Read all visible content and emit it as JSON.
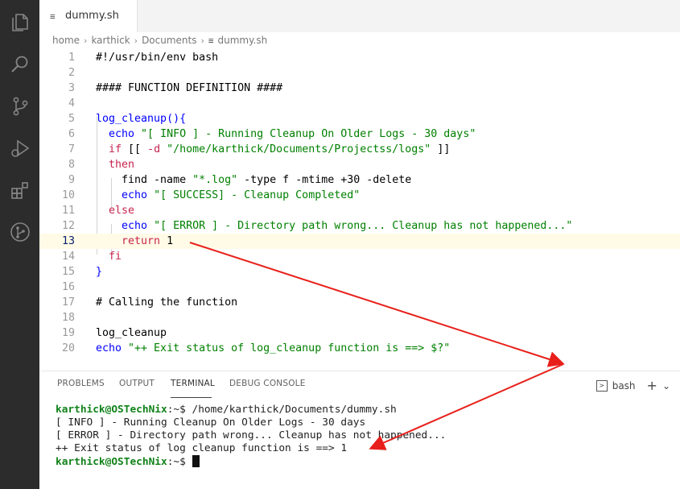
{
  "tab": {
    "label": "dummy.sh",
    "icon": "≡"
  },
  "breadcrumb": [
    "home",
    "karthick",
    "Documents",
    "dummy.sh"
  ],
  "editor": {
    "current_line": 13,
    "lines": [
      {
        "n": "1",
        "segs": [
          {
            "t": "#!/usr/bin/env bash",
            "c": "t-plain"
          }
        ]
      },
      {
        "n": "2",
        "segs": []
      },
      {
        "n": "3",
        "segs": [
          {
            "t": "#### FUNCTION DEFINITION ####",
            "c": "t-plain"
          }
        ]
      },
      {
        "n": "4",
        "segs": []
      },
      {
        "n": "5",
        "segs": [
          {
            "t": "log_cleanup",
            "c": "t-blue"
          },
          {
            "t": "(){",
            "c": "t-blue"
          }
        ]
      },
      {
        "n": "6",
        "segs": [
          {
            "t": "  echo ",
            "c": "t-blue"
          },
          {
            "t": "\"[ INFO ] - Running Cleanup On Older Logs - 30 days\"",
            "c": "cmt"
          }
        ]
      },
      {
        "n": "7",
        "segs": [
          {
            "t": "  if ",
            "c": "t-red"
          },
          {
            "t": "[[ ",
            "c": "t-plain"
          },
          {
            "t": "-d ",
            "c": "t-red"
          },
          {
            "t": "\"/home/karthick/Documents/Projectss/logs\"",
            "c": "cmt"
          },
          {
            "t": " ]]",
            "c": "t-plain"
          }
        ]
      },
      {
        "n": "8",
        "segs": [
          {
            "t": "  then",
            "c": "t-red"
          }
        ]
      },
      {
        "n": "9",
        "segs": [
          {
            "t": "    find -name ",
            "c": "t-plain"
          },
          {
            "t": "\"*.log\"",
            "c": "cmt"
          },
          {
            "t": " -type f -mtime +30 -delete",
            "c": "t-plain"
          }
        ]
      },
      {
        "n": "10",
        "segs": [
          {
            "t": "    echo ",
            "c": "t-blue"
          },
          {
            "t": "\"[ SUCCESS] - Cleanup Completed\"",
            "c": "cmt"
          }
        ]
      },
      {
        "n": "11",
        "segs": [
          {
            "t": "  else",
            "c": "t-red"
          }
        ]
      },
      {
        "n": "12",
        "segs": [
          {
            "t": "    echo ",
            "c": "t-blue"
          },
          {
            "t": "\"[ ERROR ] - Directory path wrong... Cleanup has not happened...\"",
            "c": "cmt"
          }
        ]
      },
      {
        "n": "13",
        "segs": [
          {
            "t": "    return ",
            "c": "t-red"
          },
          {
            "t": "1",
            "c": "t-plain"
          }
        ]
      },
      {
        "n": "14",
        "segs": [
          {
            "t": "  fi",
            "c": "t-red"
          }
        ]
      },
      {
        "n": "15",
        "segs": [
          {
            "t": "}",
            "c": "t-blue"
          }
        ]
      },
      {
        "n": "16",
        "segs": []
      },
      {
        "n": "17",
        "segs": [
          {
            "t": "# Calling the function",
            "c": "t-plain"
          }
        ]
      },
      {
        "n": "18",
        "segs": []
      },
      {
        "n": "19",
        "segs": [
          {
            "t": "log_cleanup",
            "c": "t-plain"
          }
        ]
      },
      {
        "n": "20",
        "segs": [
          {
            "t": "echo ",
            "c": "t-blue"
          },
          {
            "t": "\"++ Exit status of log_cleanup function is ==> $?\"",
            "c": "cmt"
          }
        ]
      }
    ]
  },
  "panel": {
    "tabs": [
      "PROBLEMS",
      "OUTPUT",
      "TERMINAL",
      "DEBUG CONSOLE"
    ],
    "active_tab": "TERMINAL",
    "shell": "bash",
    "add_label": "+",
    "dropdown": "⌄"
  },
  "terminal": {
    "user": "karthick@OSTechNix",
    "prompt_suffix_1": ":~$ /home/karthick/Documents/dummy.sh",
    "out1": "[ INFO ] - Running Cleanup On Older Logs - 30 days",
    "out2": "[ ERROR ] - Directory path wrong... Cleanup has not happened...",
    "out3": "++ Exit status of log cleanup function is ==> 1",
    "prompt_suffix_2": ":~$ "
  },
  "annotation_color": "#e8201b",
  "icons": [
    "files-icon",
    "search-icon",
    "source-control-icon",
    "run-debug-icon",
    "extensions-icon",
    "git-graph-icon"
  ]
}
